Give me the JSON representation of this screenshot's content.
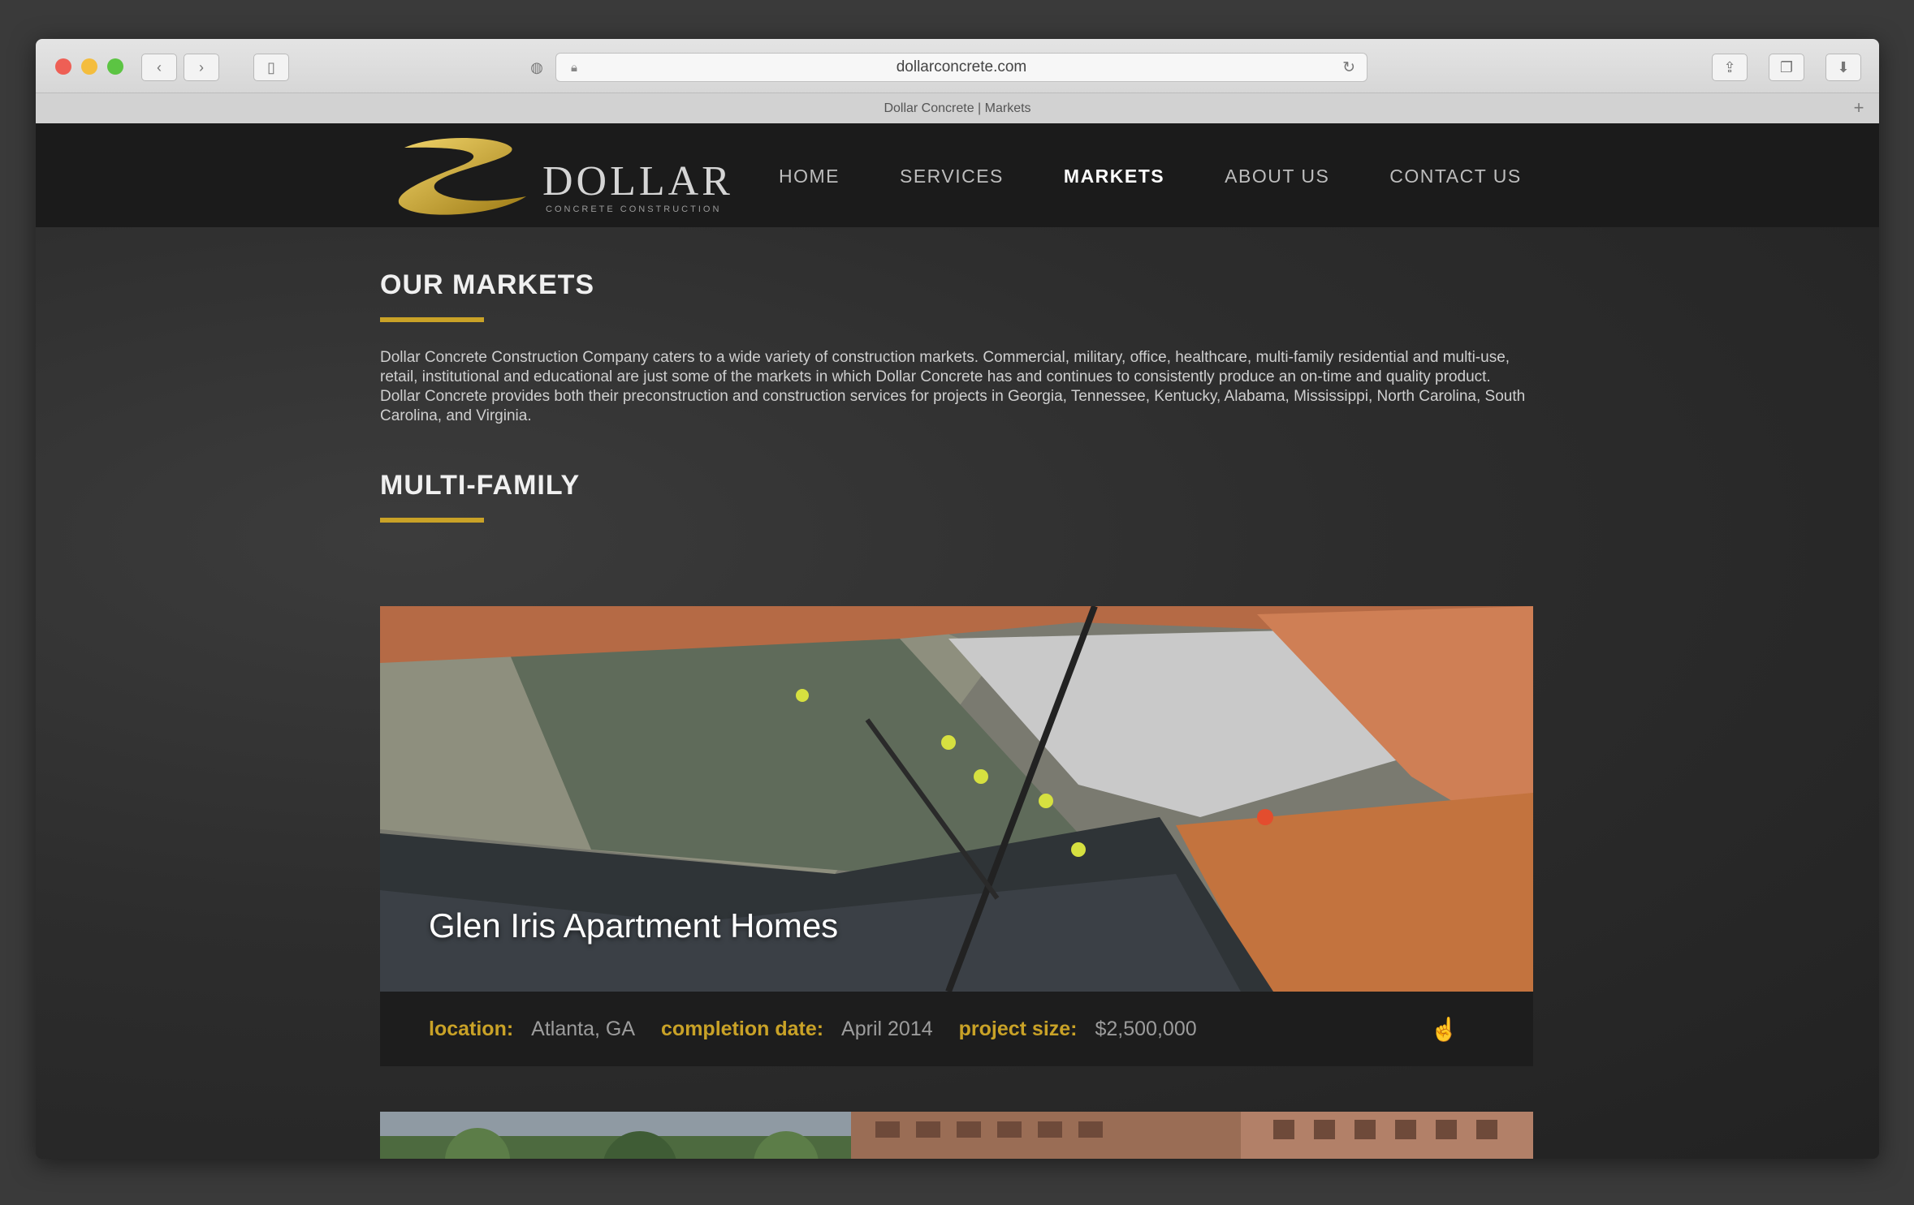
{
  "browser": {
    "url": "dollarconcrete.com",
    "tab_title": "Dollar Concrete | Markets"
  },
  "site": {
    "logo_text": "DOLLAR",
    "logo_tagline": "CONCRETE CONSTRUCTION",
    "nav": [
      {
        "label": "HOME"
      },
      {
        "label": "SERVICES"
      },
      {
        "label": "MARKETS"
      },
      {
        "label": "ABOUT US"
      },
      {
        "label": "CONTACT US"
      }
    ],
    "active_nav": "MARKETS"
  },
  "markets": {
    "heading": "OUR MARKETS",
    "intro": "Dollar Concrete Construction Company caters to a wide variety of construction markets. Commercial, military, office, healthcare, multi-family residential and multi-use, retail, institutional and educational are just some of the markets in which Dollar Concrete has and continues to consistently produce an on-time and quality product. Dollar Concrete provides both their preconstruction and construction services for projects in Georgia, Tennessee, Kentucky, Alabama, Mississippi, North Carolina, South Carolina, and Virginia.",
    "section_heading": "MULTI-FAMILY"
  },
  "project": {
    "title": "Glen Iris Apartment Homes",
    "location_label": "location:",
    "location": "Atlanta, GA",
    "completion_label": "completion date:",
    "completion": "April 2014",
    "size_label": "project size:",
    "size": "$2,500,000"
  },
  "colors": {
    "accent_gold": "#c9a227",
    "nav_bg": "#1b1b1b",
    "page_bg": "#2d2d2d"
  }
}
